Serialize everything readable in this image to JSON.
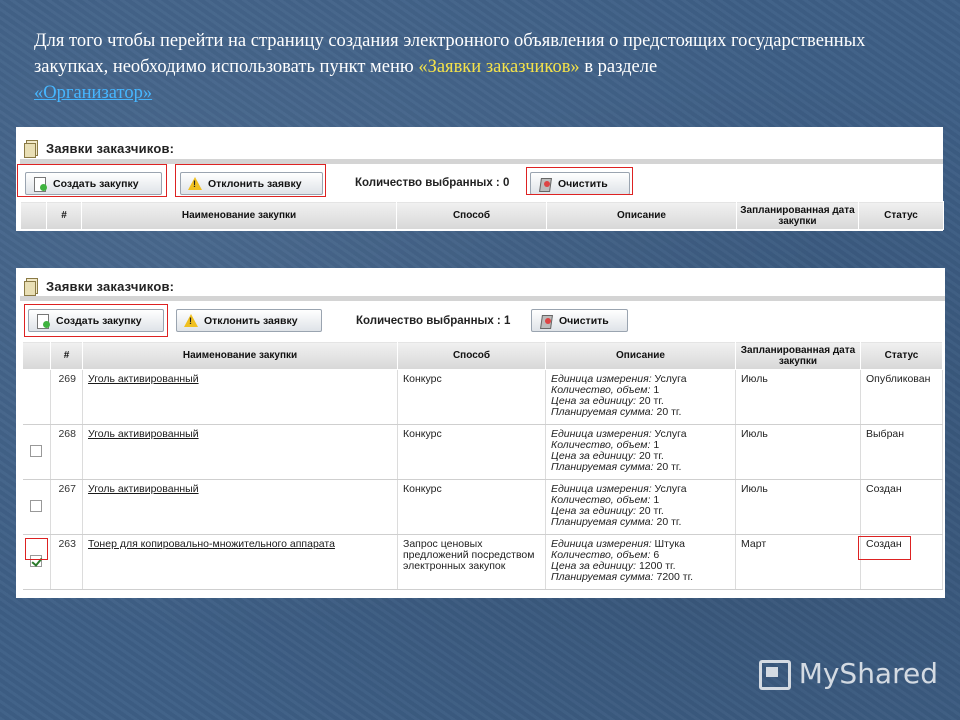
{
  "intro": {
    "text1": "Для того чтобы перейти на страницу создания электронного объявления о предстоящих государственных закупках, необходимо использовать пункт меню ",
    "highlight": "«Заявки заказчиков»",
    "text2": " в разделе ",
    "link": "«Организатор»"
  },
  "panel_title": "Заявки заказчиков:",
  "toolbar": {
    "create_label": "Создать закупку",
    "reject_label": "Отклонить заявку",
    "clear_label": "Очистить"
  },
  "panel1": {
    "count_text": "Количество выбранных : 0"
  },
  "panel2": {
    "count_text": "Количество выбранных : 1"
  },
  "columns": {
    "num": "#",
    "name": "Наименование закупки",
    "method": "Способ",
    "desc": "Описание",
    "date": "Запланированная дата закупки",
    "status": "Статус"
  },
  "desc_labels": {
    "unit": "Единица измерения:",
    "qty": "Количество, объем:",
    "price": "Цена за единицу:",
    "sum": "Планируемая сумма:"
  },
  "rows": [
    {
      "checked": false,
      "num": "269",
      "name": "Уголь активированный",
      "method": "Конкурс",
      "unit": "Услуга",
      "qty": "1",
      "price": "20 тг.",
      "sum": "20 тг.",
      "date": "Июль",
      "status": "Опубликован"
    },
    {
      "checked": false,
      "num": "268",
      "name": "Уголь активированный",
      "method": "Конкурс",
      "unit": "Услуга",
      "qty": "1",
      "price": "20 тг.",
      "sum": "20 тг.",
      "date": "Июль",
      "status": "Выбран"
    },
    {
      "checked": false,
      "num": "267",
      "name": "Уголь активированный",
      "method": "Конкурс",
      "unit": "Услуга",
      "qty": "1",
      "price": "20 тг.",
      "sum": "20 тг.",
      "date": "Июль",
      "status": "Создан"
    },
    {
      "checked": true,
      "num": "263",
      "name": "Тонер для копировально-множительного аппарата",
      "method": "Запрос ценовых предложений посредством электронных закупок",
      "unit": "Штука",
      "qty": "6",
      "price": "1200 тг.",
      "sum": "7200 тг.",
      "date": "Март",
      "status": "Создан"
    }
  ],
  "logo": "MyShared"
}
